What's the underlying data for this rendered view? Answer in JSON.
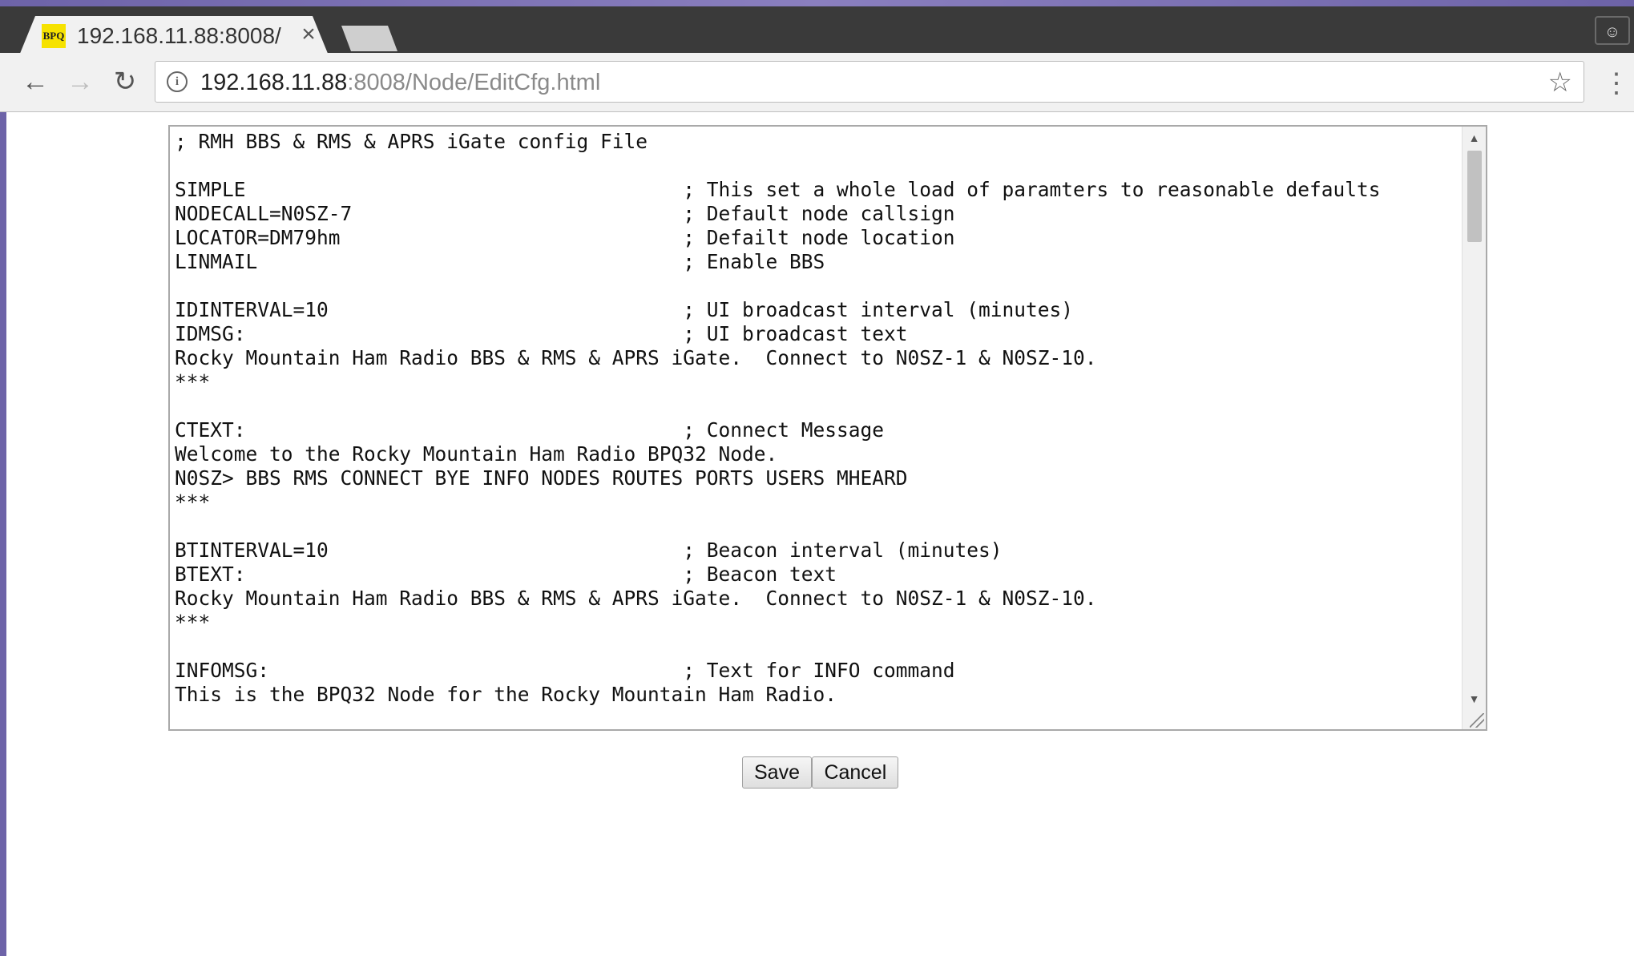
{
  "browser": {
    "tab": {
      "favicon_text": "BPQ",
      "title": "192.168.11.88:8008/",
      "close_glyph": "×"
    },
    "address_bar": {
      "url_host": "192.168.11.88",
      "url_rest": ":8008/Node/EditCfg.html"
    },
    "icons": {
      "back": "back-arrow-icon",
      "forward": "forward-arrow-icon",
      "reload": "reload-icon",
      "info": "info-icon",
      "star": "star-icon",
      "menu": "kebab-menu-icon",
      "profile": "profile-icon"
    }
  },
  "editor": {
    "content": "; RMH BBS & RMS & APRS iGate config File\n\nSIMPLE                                     ; This set a whole load of paramters to reasonable defaults\nNODECALL=N0SZ-7                            ; Default node callsign\nLOCATOR=DM79hm                             ; Defailt node location\nLINMAIL                                    ; Enable BBS\n\nIDINTERVAL=10                              ; UI broadcast interval (minutes)\nIDMSG:                                     ; UI broadcast text\nRocky Mountain Ham Radio BBS & RMS & APRS iGate.  Connect to N0SZ-1 & N0SZ-10.\n***\n\nCTEXT:                                     ; Connect Message\nWelcome to the Rocky Mountain Ham Radio BPQ32 Node.\nN0SZ> BBS RMS CONNECT BYE INFO NODES ROUTES PORTS USERS MHEARD\n***\n\nBTINTERVAL=10                              ; Beacon interval (minutes)\nBTEXT:                                     ; Beacon text\nRocky Mountain Ham Radio BBS & RMS & APRS iGate.  Connect to N0SZ-1 & N0SZ-10.\n***\n\nINFOMSG:                                   ; Text for INFO command\nThis is the BPQ32 Node for the Rocky Mountain Ham Radio."
  },
  "actions": {
    "save_label": "Save",
    "cancel_label": "Cancel"
  }
}
